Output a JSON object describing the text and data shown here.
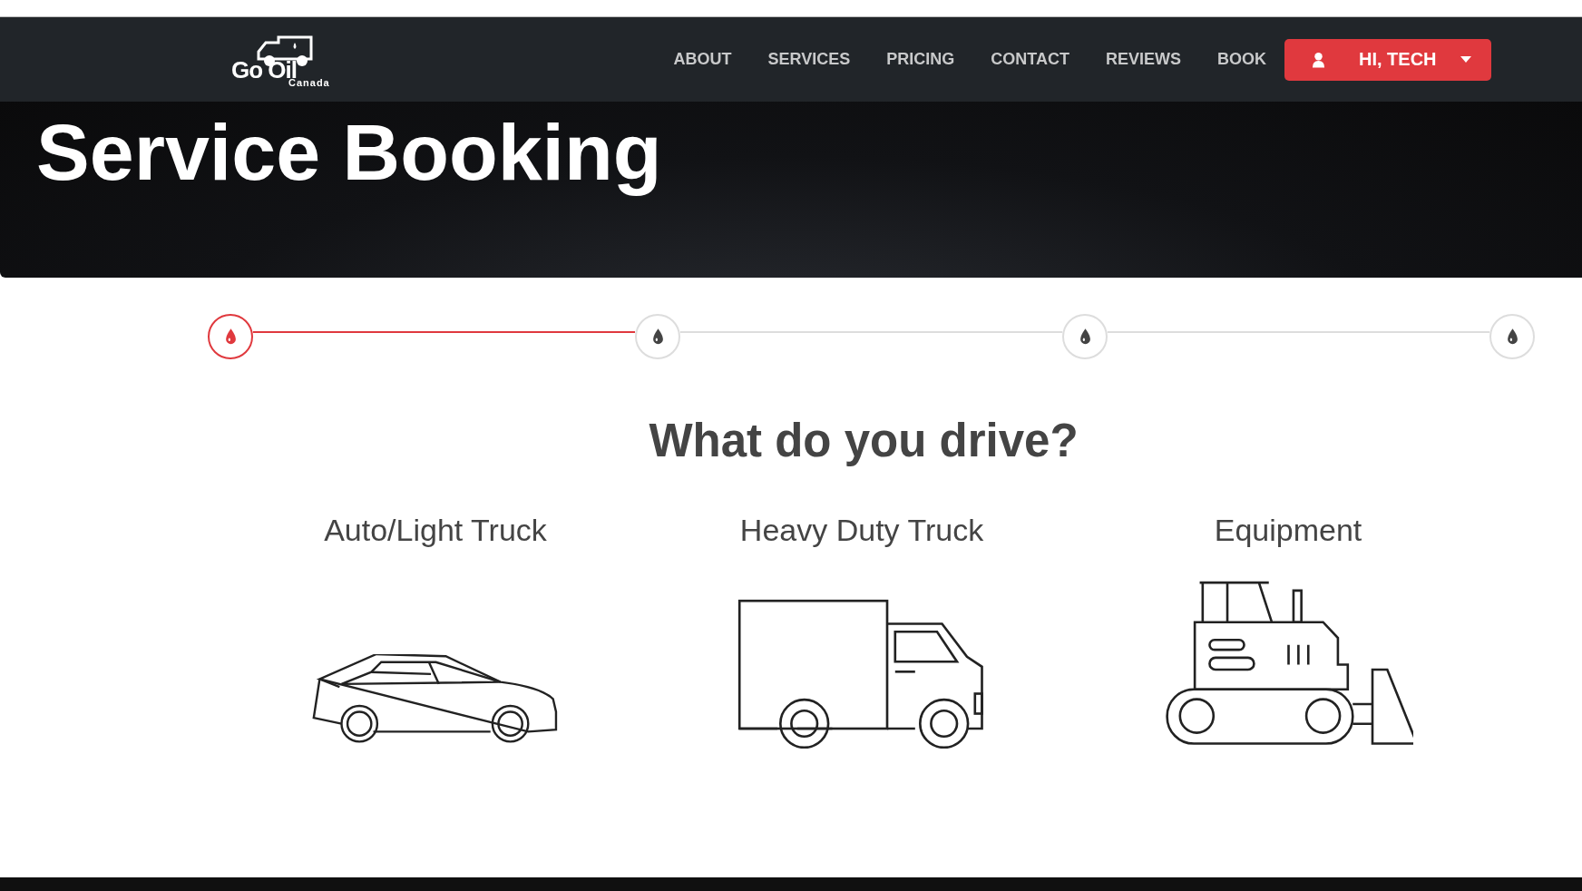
{
  "navbar": {
    "logo": {
      "wordmark": "Go Oil",
      "subtitle": "Canada"
    },
    "links": [
      {
        "label": "ABOUT"
      },
      {
        "label": "SERVICES"
      },
      {
        "label": "PRICING"
      },
      {
        "label": "CONTACT"
      },
      {
        "label": "REVIEWS"
      },
      {
        "label": "BOOK"
      }
    ],
    "user_button": {
      "label": "HI, TECH"
    }
  },
  "hero": {
    "title": "Service Booking"
  },
  "stepper": {
    "steps": [
      {
        "selected": true
      },
      {
        "selected": false
      },
      {
        "selected": false
      },
      {
        "selected": false
      }
    ]
  },
  "question": {
    "heading": "What do you drive?"
  },
  "vehicles": [
    {
      "kind": "car",
      "label": "Auto/Light Truck"
    },
    {
      "kind": "truck",
      "label": "Heavy Duty Truck"
    },
    {
      "kind": "equipment",
      "label": "Equipment"
    }
  ]
}
